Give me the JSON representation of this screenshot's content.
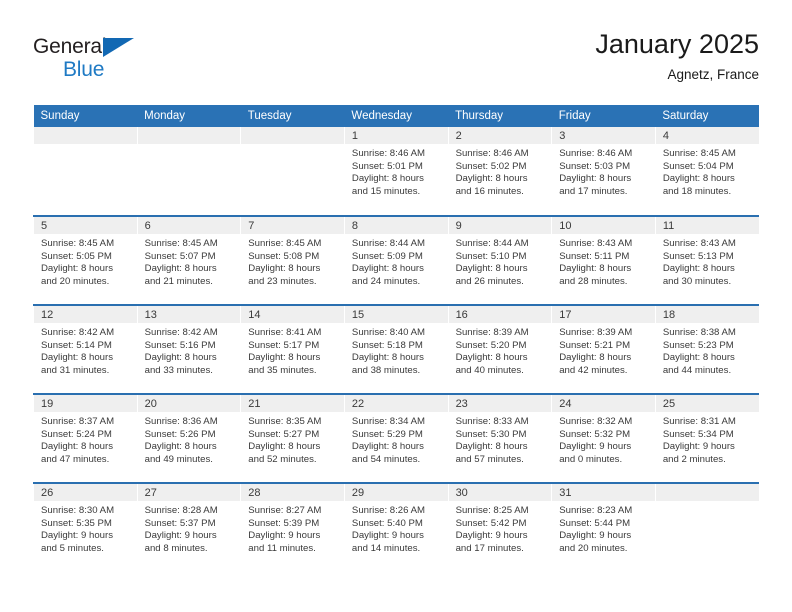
{
  "brand": {
    "name_top": "General",
    "name_bottom": "Blue",
    "triangle_color": "#1268b3",
    "blue_text_color": "#1f7ac4"
  },
  "header": {
    "title": "January 2025",
    "subtitle": "Agnetz, France"
  },
  "theme": {
    "header_blue": "#2a72b5",
    "separator_blue": "#2a6fb0",
    "daynum_band": "#efefef",
    "text": "#3a3a3a"
  },
  "weekday_headers": [
    "Sunday",
    "Monday",
    "Tuesday",
    "Wednesday",
    "Thursday",
    "Friday",
    "Saturday"
  ],
  "weeks": [
    [
      {
        "day": "",
        "sunrise": "",
        "sunset": "",
        "daylight_line1": "",
        "daylight_line2": "",
        "empty": true
      },
      {
        "day": "",
        "sunrise": "",
        "sunset": "",
        "daylight_line1": "",
        "daylight_line2": "",
        "empty": true
      },
      {
        "day": "",
        "sunrise": "",
        "sunset": "",
        "daylight_line1": "",
        "daylight_line2": "",
        "empty": true
      },
      {
        "day": "1",
        "sunrise": "Sunrise: 8:46 AM",
        "sunset": "Sunset: 5:01 PM",
        "daylight_line1": "Daylight: 8 hours",
        "daylight_line2": "and 15 minutes.",
        "empty": false
      },
      {
        "day": "2",
        "sunrise": "Sunrise: 8:46 AM",
        "sunset": "Sunset: 5:02 PM",
        "daylight_line1": "Daylight: 8 hours",
        "daylight_line2": "and 16 minutes.",
        "empty": false
      },
      {
        "day": "3",
        "sunrise": "Sunrise: 8:46 AM",
        "sunset": "Sunset: 5:03 PM",
        "daylight_line1": "Daylight: 8 hours",
        "daylight_line2": "and 17 minutes.",
        "empty": false
      },
      {
        "day": "4",
        "sunrise": "Sunrise: 8:45 AM",
        "sunset": "Sunset: 5:04 PM",
        "daylight_line1": "Daylight: 8 hours",
        "daylight_line2": "and 18 minutes.",
        "empty": false
      }
    ],
    [
      {
        "day": "5",
        "sunrise": "Sunrise: 8:45 AM",
        "sunset": "Sunset: 5:05 PM",
        "daylight_line1": "Daylight: 8 hours",
        "daylight_line2": "and 20 minutes.",
        "empty": false
      },
      {
        "day": "6",
        "sunrise": "Sunrise: 8:45 AM",
        "sunset": "Sunset: 5:07 PM",
        "daylight_line1": "Daylight: 8 hours",
        "daylight_line2": "and 21 minutes.",
        "empty": false
      },
      {
        "day": "7",
        "sunrise": "Sunrise: 8:45 AM",
        "sunset": "Sunset: 5:08 PM",
        "daylight_line1": "Daylight: 8 hours",
        "daylight_line2": "and 23 minutes.",
        "empty": false
      },
      {
        "day": "8",
        "sunrise": "Sunrise: 8:44 AM",
        "sunset": "Sunset: 5:09 PM",
        "daylight_line1": "Daylight: 8 hours",
        "daylight_line2": "and 24 minutes.",
        "empty": false
      },
      {
        "day": "9",
        "sunrise": "Sunrise: 8:44 AM",
        "sunset": "Sunset: 5:10 PM",
        "daylight_line1": "Daylight: 8 hours",
        "daylight_line2": "and 26 minutes.",
        "empty": false
      },
      {
        "day": "10",
        "sunrise": "Sunrise: 8:43 AM",
        "sunset": "Sunset: 5:11 PM",
        "daylight_line1": "Daylight: 8 hours",
        "daylight_line2": "and 28 minutes.",
        "empty": false
      },
      {
        "day": "11",
        "sunrise": "Sunrise: 8:43 AM",
        "sunset": "Sunset: 5:13 PM",
        "daylight_line1": "Daylight: 8 hours",
        "daylight_line2": "and 30 minutes.",
        "empty": false
      }
    ],
    [
      {
        "day": "12",
        "sunrise": "Sunrise: 8:42 AM",
        "sunset": "Sunset: 5:14 PM",
        "daylight_line1": "Daylight: 8 hours",
        "daylight_line2": "and 31 minutes.",
        "empty": false
      },
      {
        "day": "13",
        "sunrise": "Sunrise: 8:42 AM",
        "sunset": "Sunset: 5:16 PM",
        "daylight_line1": "Daylight: 8 hours",
        "daylight_line2": "and 33 minutes.",
        "empty": false
      },
      {
        "day": "14",
        "sunrise": "Sunrise: 8:41 AM",
        "sunset": "Sunset: 5:17 PM",
        "daylight_line1": "Daylight: 8 hours",
        "daylight_line2": "and 35 minutes.",
        "empty": false
      },
      {
        "day": "15",
        "sunrise": "Sunrise: 8:40 AM",
        "sunset": "Sunset: 5:18 PM",
        "daylight_line1": "Daylight: 8 hours",
        "daylight_line2": "and 38 minutes.",
        "empty": false
      },
      {
        "day": "16",
        "sunrise": "Sunrise: 8:39 AM",
        "sunset": "Sunset: 5:20 PM",
        "daylight_line1": "Daylight: 8 hours",
        "daylight_line2": "and 40 minutes.",
        "empty": false
      },
      {
        "day": "17",
        "sunrise": "Sunrise: 8:39 AM",
        "sunset": "Sunset: 5:21 PM",
        "daylight_line1": "Daylight: 8 hours",
        "daylight_line2": "and 42 minutes.",
        "empty": false
      },
      {
        "day": "18",
        "sunrise": "Sunrise: 8:38 AM",
        "sunset": "Sunset: 5:23 PM",
        "daylight_line1": "Daylight: 8 hours",
        "daylight_line2": "and 44 minutes.",
        "empty": false
      }
    ],
    [
      {
        "day": "19",
        "sunrise": "Sunrise: 8:37 AM",
        "sunset": "Sunset: 5:24 PM",
        "daylight_line1": "Daylight: 8 hours",
        "daylight_line2": "and 47 minutes.",
        "empty": false
      },
      {
        "day": "20",
        "sunrise": "Sunrise: 8:36 AM",
        "sunset": "Sunset: 5:26 PM",
        "daylight_line1": "Daylight: 8 hours",
        "daylight_line2": "and 49 minutes.",
        "empty": false
      },
      {
        "day": "21",
        "sunrise": "Sunrise: 8:35 AM",
        "sunset": "Sunset: 5:27 PM",
        "daylight_line1": "Daylight: 8 hours",
        "daylight_line2": "and 52 minutes.",
        "empty": false
      },
      {
        "day": "22",
        "sunrise": "Sunrise: 8:34 AM",
        "sunset": "Sunset: 5:29 PM",
        "daylight_line1": "Daylight: 8 hours",
        "daylight_line2": "and 54 minutes.",
        "empty": false
      },
      {
        "day": "23",
        "sunrise": "Sunrise: 8:33 AM",
        "sunset": "Sunset: 5:30 PM",
        "daylight_line1": "Daylight: 8 hours",
        "daylight_line2": "and 57 minutes.",
        "empty": false
      },
      {
        "day": "24",
        "sunrise": "Sunrise: 8:32 AM",
        "sunset": "Sunset: 5:32 PM",
        "daylight_line1": "Daylight: 9 hours",
        "daylight_line2": "and 0 minutes.",
        "empty": false
      },
      {
        "day": "25",
        "sunrise": "Sunrise: 8:31 AM",
        "sunset": "Sunset: 5:34 PM",
        "daylight_line1": "Daylight: 9 hours",
        "daylight_line2": "and 2 minutes.",
        "empty": false
      }
    ],
    [
      {
        "day": "26",
        "sunrise": "Sunrise: 8:30 AM",
        "sunset": "Sunset: 5:35 PM",
        "daylight_line1": "Daylight: 9 hours",
        "daylight_line2": "and 5 minutes.",
        "empty": false
      },
      {
        "day": "27",
        "sunrise": "Sunrise: 8:28 AM",
        "sunset": "Sunset: 5:37 PM",
        "daylight_line1": "Daylight: 9 hours",
        "daylight_line2": "and 8 minutes.",
        "empty": false
      },
      {
        "day": "28",
        "sunrise": "Sunrise: 8:27 AM",
        "sunset": "Sunset: 5:39 PM",
        "daylight_line1": "Daylight: 9 hours",
        "daylight_line2": "and 11 minutes.",
        "empty": false
      },
      {
        "day": "29",
        "sunrise": "Sunrise: 8:26 AM",
        "sunset": "Sunset: 5:40 PM",
        "daylight_line1": "Daylight: 9 hours",
        "daylight_line2": "and 14 minutes.",
        "empty": false
      },
      {
        "day": "30",
        "sunrise": "Sunrise: 8:25 AM",
        "sunset": "Sunset: 5:42 PM",
        "daylight_line1": "Daylight: 9 hours",
        "daylight_line2": "and 17 minutes.",
        "empty": false
      },
      {
        "day": "31",
        "sunrise": "Sunrise: 8:23 AM",
        "sunset": "Sunset: 5:44 PM",
        "daylight_line1": "Daylight: 9 hours",
        "daylight_line2": "and 20 minutes.",
        "empty": false
      },
      {
        "day": "",
        "sunrise": "",
        "sunset": "",
        "daylight_line1": "",
        "daylight_line2": "",
        "empty": true
      }
    ]
  ]
}
